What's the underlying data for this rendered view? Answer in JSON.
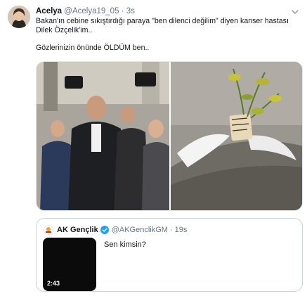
{
  "tweet": {
    "author_name": "Acelya",
    "handle": "@Acelya19_05",
    "separator": "·",
    "time": "3s",
    "lines": [
      "Bakan'ın cebine sıkıştırdığı paraya \"ben dilenci değilim\" diyen kanser hastası",
      "Dilek Özçelik'im..",
      "Gözlerinizin önünde ÖLDÜM ben.."
    ],
    "caret_icon": "chevron-down-icon"
  },
  "media": {
    "images": [
      "crowd-photo",
      "grave-photo"
    ]
  },
  "quoted_tweet": {
    "author_name": "AK Gençlik",
    "verified": true,
    "handle": "@AKGenclikGM",
    "separator": "·",
    "time": "19s",
    "text": "Sen kimsin?",
    "video_duration": "2:43"
  },
  "colors": {
    "text": "#14171a",
    "secondary": "#657786",
    "border": "#ccd6dd",
    "verified": "#1da1f2"
  }
}
